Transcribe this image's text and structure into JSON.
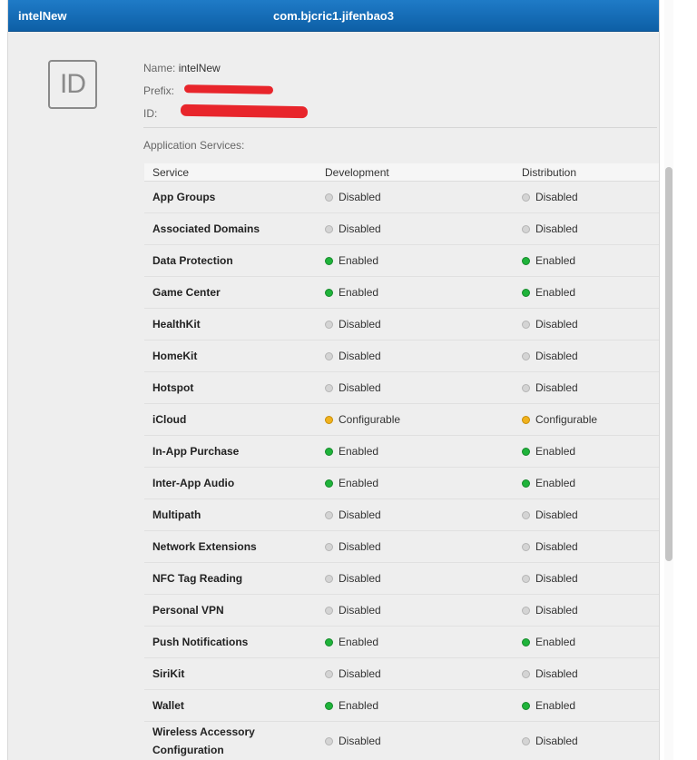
{
  "titlebar": {
    "left_title": "intelNew",
    "bundle_id": "com.bjcric1.jifenbao3"
  },
  "icon": {
    "label": "ID",
    "name": "id-icon"
  },
  "details": {
    "name_label": "Name:",
    "name_value": "intelNew",
    "prefix_label": "Prefix:",
    "id_label": "ID:"
  },
  "section_title": "Application Services:",
  "table": {
    "headers": [
      "Service",
      "Development",
      "Distribution"
    ],
    "rows": [
      {
        "service": "App Groups",
        "dev": "Disabled",
        "dist": "Disabled",
        "dev_status": "disabled",
        "dist_status": "disabled"
      },
      {
        "service": "Associated Domains",
        "dev": "Disabled",
        "dist": "Disabled",
        "dev_status": "disabled",
        "dist_status": "disabled"
      },
      {
        "service": "Data Protection",
        "dev": "Enabled",
        "dist": "Enabled",
        "dev_status": "enabled",
        "dist_status": "enabled"
      },
      {
        "service": "Game Center",
        "dev": "Enabled",
        "dist": "Enabled",
        "dev_status": "enabled",
        "dist_status": "enabled"
      },
      {
        "service": "HealthKit",
        "dev": "Disabled",
        "dist": "Disabled",
        "dev_status": "disabled",
        "dist_status": "disabled"
      },
      {
        "service": "HomeKit",
        "dev": "Disabled",
        "dist": "Disabled",
        "dev_status": "disabled",
        "dist_status": "disabled"
      },
      {
        "service": "Hotspot",
        "dev": "Disabled",
        "dist": "Disabled",
        "dev_status": "disabled",
        "dist_status": "disabled"
      },
      {
        "service": "iCloud",
        "dev": "Configurable",
        "dist": "Configurable",
        "dev_status": "configurable",
        "dist_status": "configurable"
      },
      {
        "service": "In-App Purchase",
        "dev": "Enabled",
        "dist": "Enabled",
        "dev_status": "enabled",
        "dist_status": "enabled"
      },
      {
        "service": "Inter-App Audio",
        "dev": "Enabled",
        "dist": "Enabled",
        "dev_status": "enabled",
        "dist_status": "enabled"
      },
      {
        "service": "Multipath",
        "dev": "Disabled",
        "dist": "Disabled",
        "dev_status": "disabled",
        "dist_status": "disabled"
      },
      {
        "service": "Network Extensions",
        "dev": "Disabled",
        "dist": "Disabled",
        "dev_status": "disabled",
        "dist_status": "disabled"
      },
      {
        "service": "NFC Tag Reading",
        "dev": "Disabled",
        "dist": "Disabled",
        "dev_status": "disabled",
        "dist_status": "disabled"
      },
      {
        "service": "Personal VPN",
        "dev": "Disabled",
        "dist": "Disabled",
        "dev_status": "disabled",
        "dist_status": "disabled"
      },
      {
        "service": "Push Notifications",
        "dev": "Enabled",
        "dist": "Enabled",
        "dev_status": "enabled",
        "dist_status": "enabled"
      },
      {
        "service": "SiriKit",
        "dev": "Disabled",
        "dist": "Disabled",
        "dev_status": "disabled",
        "dist_status": "disabled"
      },
      {
        "service": "Wallet",
        "dev": "Enabled",
        "dist": "Enabled",
        "dev_status": "enabled",
        "dist_status": "enabled"
      },
      {
        "service": "Wireless Accessory Configuration",
        "dev": "Disabled",
        "dist": "Disabled",
        "dev_status": "disabled",
        "dist_status": "disabled"
      }
    ]
  },
  "colors": {
    "titlebar": "#0d5fa6",
    "enabled": "#1fb33a",
    "disabled": "#d4d4d4",
    "configurable": "#f0b21e",
    "redaction": "#e8252b"
  }
}
